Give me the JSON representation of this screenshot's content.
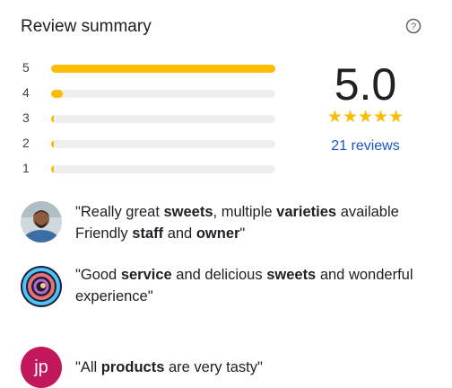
{
  "header": {
    "title": "Review summary",
    "help_icon": "help-circle-icon"
  },
  "distribution": [
    {
      "stars": "5",
      "fraction": 1.0
    },
    {
      "stars": "4",
      "fraction": 0.05
    },
    {
      "stars": "3",
      "fraction": 0.0
    },
    {
      "stars": "2",
      "fraction": 0.0
    },
    {
      "stars": "1",
      "fraction": 0.0
    }
  ],
  "summary": {
    "rating": "5.0",
    "stars": "★★★★★",
    "star_count": 5,
    "reviews_label": "21 reviews"
  },
  "colors": {
    "bar": "#fbbc04",
    "track": "#eeeeee",
    "link": "#1a56c4",
    "jp_avatar": "#c2185b"
  },
  "snippets": [
    {
      "avatar": "photo-avatar",
      "parts": [
        {
          "t": "\"Really great ",
          "b": false
        },
        {
          "t": "sweets",
          "b": true
        },
        {
          "t": ", multiple ",
          "b": false
        },
        {
          "t": "varieties",
          "b": true
        },
        {
          "t": " available Friendly ",
          "b": false
        },
        {
          "t": "staff",
          "b": true
        },
        {
          "t": " and ",
          "b": false
        },
        {
          "t": "owner",
          "b": true
        },
        {
          "t": "\"",
          "b": false
        }
      ]
    },
    {
      "avatar": "swirl-avatar",
      "parts": [
        {
          "t": "\"Good ",
          "b": false
        },
        {
          "t": "service",
          "b": true
        },
        {
          "t": " and delicious ",
          "b": false
        },
        {
          "t": "sweets",
          "b": true
        },
        {
          "t": " and wonderful experience\"",
          "b": false
        }
      ]
    },
    {
      "avatar": "initials-avatar",
      "initials": "jp",
      "parts": [
        {
          "t": "\"All ",
          "b": false
        },
        {
          "t": "products",
          "b": true
        },
        {
          "t": " are very tasty\"",
          "b": false
        }
      ]
    }
  ]
}
